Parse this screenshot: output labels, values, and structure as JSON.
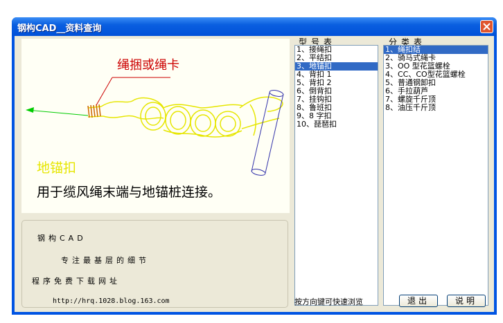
{
  "window": {
    "title": "钢构CAD__资料查询"
  },
  "preview": {
    "callout_label": "绳捆或绳卡",
    "knot_name": "地锚扣",
    "description": "用于缆风绳末端与地锚桩连接。"
  },
  "info": {
    "line1": "钢构CAD",
    "line2": "专注最基层的细节",
    "line3": "程序免费下载网址",
    "url": "http://hrq.1028.blog.163.com"
  },
  "type_list": {
    "label": "型号表",
    "selected_index": 2,
    "items": [
      "1、接绳扣",
      "2、平结扣",
      "3、地锚扣",
      "4、背扣 1",
      "5、背扣 2",
      "6、倒背扣",
      "7、挂钩扣",
      "8、鲁班扣",
      "9、8 字扣",
      "10、琵琶扣"
    ]
  },
  "category_list": {
    "label": "分类表",
    "selected_index": 0,
    "items": [
      "1、绳扣结",
      "2、骑马式绳卡",
      "3、OO 型花篮螺栓",
      "4、CC、CO型花篮螺栓",
      "5、普通钢卸扣",
      "6、手拉葫芦",
      "7、螺旋千斤顶",
      "8、油压千斤顶"
    ]
  },
  "footer": {
    "hint": "按方向键可快速浏览",
    "exit_label": "退出",
    "help_label": "说明"
  }
}
